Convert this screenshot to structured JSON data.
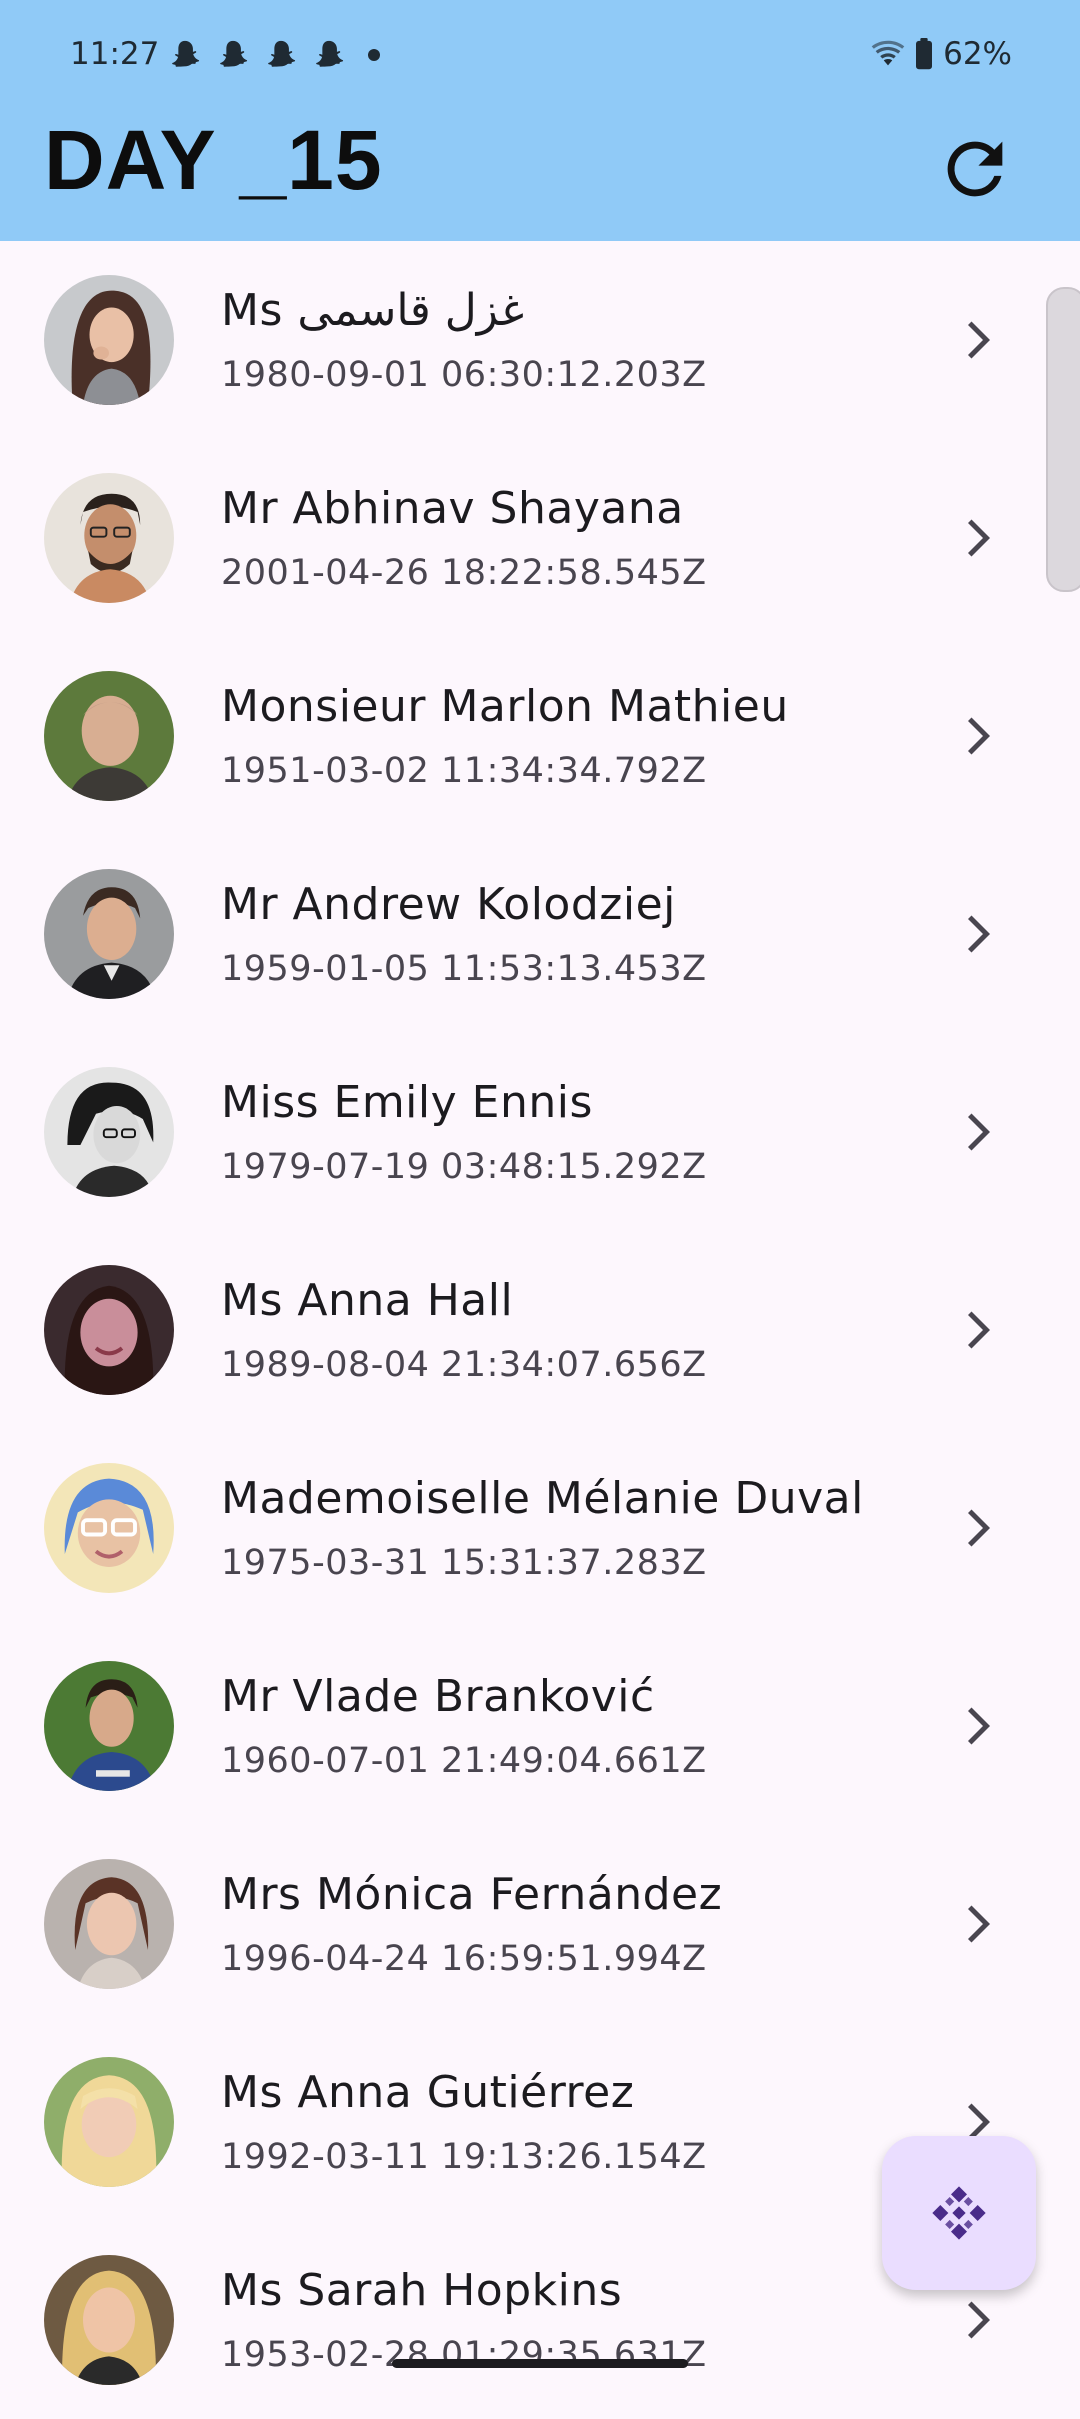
{
  "status_bar": {
    "time": "11:27",
    "battery": "62%",
    "notification_icons": [
      "snapchat-icon",
      "snapchat-icon",
      "snapchat-icon",
      "snapchat-icon"
    ]
  },
  "app_bar": {
    "title": "DAY _15",
    "background": "#90caf7",
    "refresh_icon": "refresh-icon"
  },
  "users": [
    {
      "name": "Ms غزل قاسمی",
      "date": "1980-09-01 06:30:12.203Z"
    },
    {
      "name": "Mr Abhinav Shayana",
      "date": "2001-04-26 18:22:58.545Z"
    },
    {
      "name": "Monsieur Marlon Mathieu",
      "date": "1951-03-02 11:34:34.792Z"
    },
    {
      "name": "Mr Andrew Kolodziej",
      "date": "1959-01-05 11:53:13.453Z"
    },
    {
      "name": "Miss Emily Ennis",
      "date": "1979-07-19 03:48:15.292Z"
    },
    {
      "name": "Ms Anna Hall",
      "date": "1989-08-04 21:34:07.656Z"
    },
    {
      "name": "Mademoiselle Mélanie Duval",
      "date": "1975-03-31 15:31:37.283Z"
    },
    {
      "name": "Mr Vlade Branković",
      "date": "1960-07-01 21:49:04.661Z"
    },
    {
      "name": "Mrs Mónica Fernández",
      "date": "1996-04-24 16:59:51.994Z"
    },
    {
      "name": "Ms Anna Gutiérrez",
      "date": "1992-03-11 19:13:26.154Z"
    },
    {
      "name": "Ms Sarah Hopkins",
      "date": "1953-02-28 01:29:35.631Z"
    }
  ],
  "fab": {
    "icon": "diamond-pattern-icon",
    "background": "#eaddff",
    "icon_color": "#4a2c8a"
  }
}
